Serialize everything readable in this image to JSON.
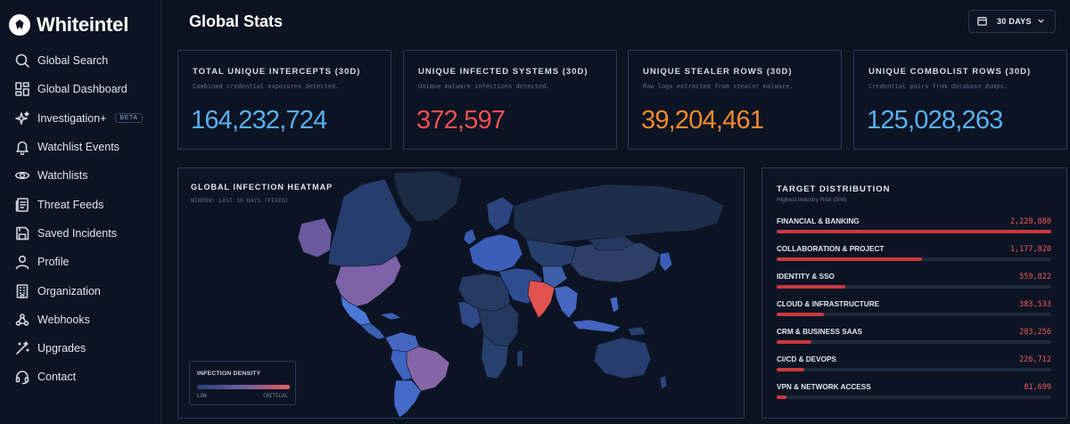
{
  "brand": {
    "name": "Whiteintel"
  },
  "sidebar": {
    "items": [
      {
        "label": "Global Search",
        "icon": "search-icon"
      },
      {
        "label": "Global Dashboard",
        "icon": "dashboard-icon"
      },
      {
        "label": "Investigation+",
        "icon": "sparkle-icon",
        "badge": "BETA"
      },
      {
        "label": "Watchlist Events",
        "icon": "bell-icon"
      },
      {
        "label": "Watchlists",
        "icon": "eye-icon"
      },
      {
        "label": "Threat Feeds",
        "icon": "feed-icon"
      },
      {
        "label": "Saved Incidents",
        "icon": "save-icon"
      },
      {
        "label": "Profile",
        "icon": "user-icon"
      },
      {
        "label": "Organization",
        "icon": "building-icon"
      },
      {
        "label": "Webhooks",
        "icon": "webhook-icon"
      },
      {
        "label": "Upgrades",
        "icon": "wand-icon"
      },
      {
        "label": "Contact",
        "icon": "headset-icon"
      }
    ]
  },
  "header": {
    "title": "Global Stats",
    "range_label": "30 DAYS"
  },
  "cards": [
    {
      "title": "TOTAL UNIQUE INTERCEPTS (30D)",
      "subtitle": "Combined credential exposures detected.",
      "value": "164,232,724",
      "color": "#5ab0f0"
    },
    {
      "title": "UNIQUE INFECTED SYSTEMS (30D)",
      "subtitle": "Unique malware infections detected.",
      "value": "372,597",
      "color": "#ef5050"
    },
    {
      "title": "UNIQUE STEALER ROWS (30D)",
      "subtitle": "Raw logs extracted from stealer malware.",
      "value": "39,204,461",
      "color": "#f08a2c"
    },
    {
      "title": "UNIQUE COMBOLIST ROWS (30D)",
      "subtitle": "Credential pairs from database dumps.",
      "value": "125,028,263",
      "color": "#5ab0f0"
    }
  ],
  "heatmap": {
    "title": "GLOBAL INFECTION HEATMAP",
    "subtitle": "WINDOW: LAST 30 DAYS (FIXED)",
    "legend": {
      "title": "INFECTION DENSITY",
      "low": "LOW",
      "high": "CRITICAL"
    }
  },
  "target": {
    "title": "TARGET DISTRIBUTION",
    "subtitle": "Highest Industry Risk (30d)",
    "rows": [
      {
        "name": "FINANCIAL & BANKING",
        "value": "2,229,880",
        "share": 1.0
      },
      {
        "name": "COLLABORATION & PROJECT",
        "value": "1,177,820",
        "share": 0.528
      },
      {
        "name": "IDENTITY & SSO",
        "value": "559,822",
        "share": 0.251
      },
      {
        "name": "CLOUD & INFRASTRUCTURE",
        "value": "383,533",
        "share": 0.172
      },
      {
        "name": "CRM & BUSINESS SAAS",
        "value": "283,256",
        "share": 0.127
      },
      {
        "name": "CI/CD & DEVOPS",
        "value": "226,712",
        "share": 0.102
      },
      {
        "name": "VPN & NETWORK ACCESS",
        "value": "81,699",
        "share": 0.037
      }
    ]
  }
}
